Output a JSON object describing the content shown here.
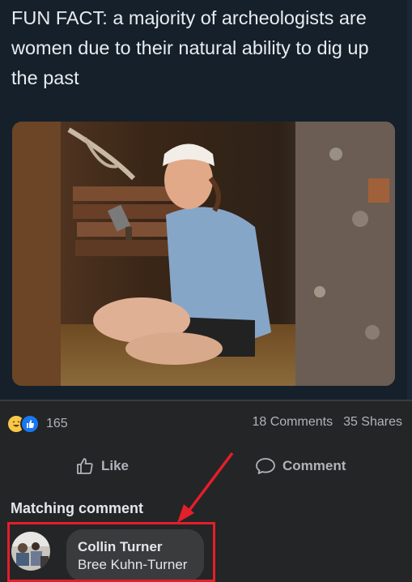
{
  "meme": {
    "text": "FUN FACT: a majority of archeologists are women due to their natural ability to dig up the past"
  },
  "post": {
    "reaction_count": "165",
    "comments": "18 Comments",
    "shares": "35 Shares",
    "reaction_icons": [
      "haha-icon",
      "like-icon"
    ]
  },
  "actions": {
    "like_label": "Like",
    "comment_label": "Comment"
  },
  "matching": {
    "title": "Matching comment",
    "commenter": "Collin Turner",
    "tagged": "Bree Kuhn-Turner"
  },
  "colors": {
    "background": "#242526",
    "meme_background": "#15202b",
    "annotation": "#e41e2b",
    "bubble": "#3a3b3c"
  }
}
